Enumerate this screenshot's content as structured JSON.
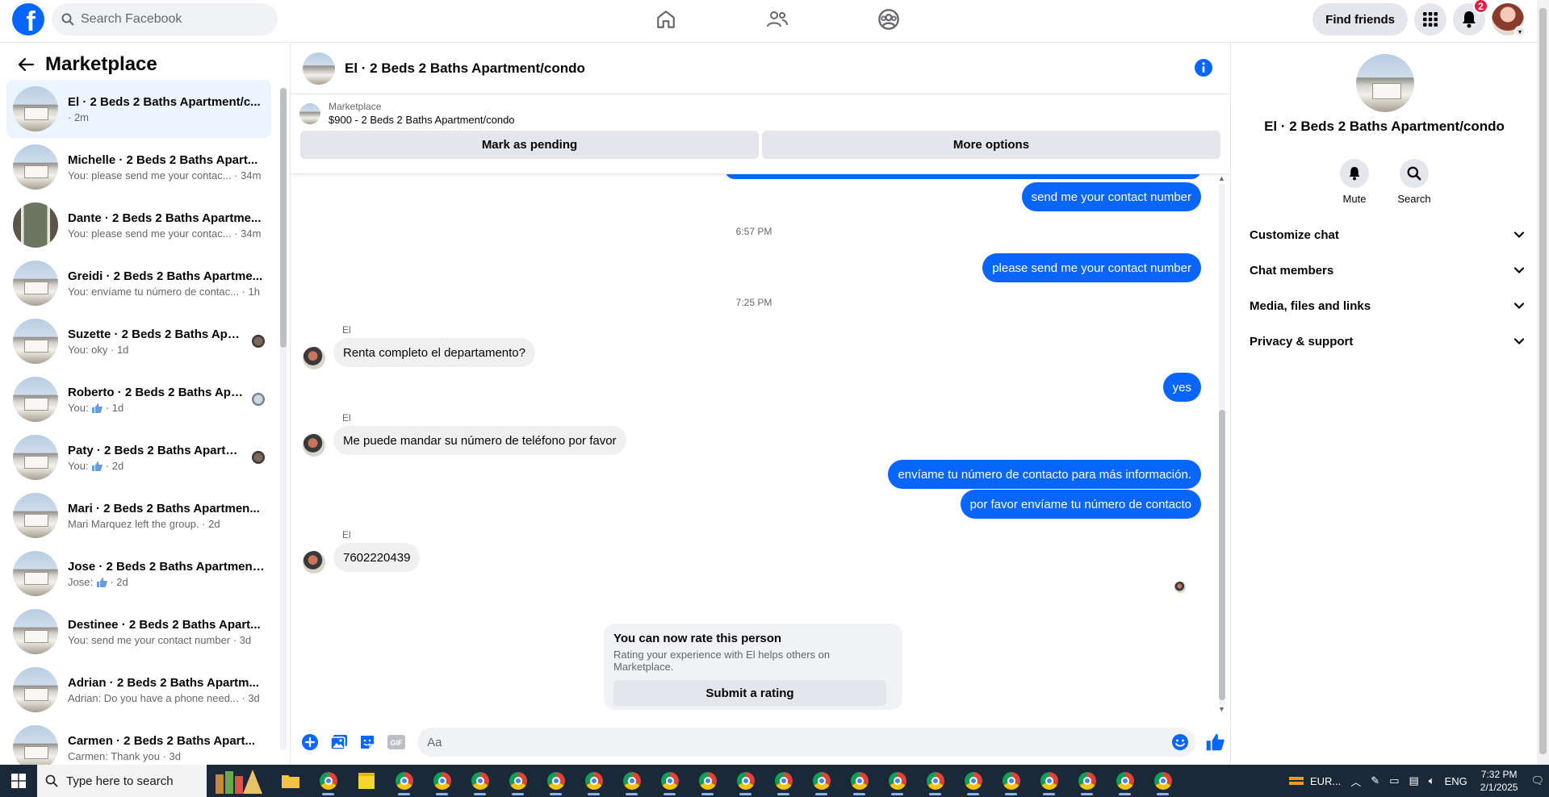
{
  "topnav": {
    "logo": "f",
    "search_placeholder": "Search Facebook",
    "find_friends": "Find friends",
    "notification_count": "2"
  },
  "sidebar": {
    "title": "Marketplace",
    "conversations": [
      {
        "name": "El · 2 Beds 2 Baths Apartment/c...",
        "sub": "· 2m",
        "active": true
      },
      {
        "name": "Michelle · 2 Beds 2 Baths Apart...",
        "sub": "You: please send me your contac... · 34m"
      },
      {
        "name": "Dante · 2 Beds 2 Baths Apartme...",
        "sub": "You: please send me your contac... · 34m"
      },
      {
        "name": "Greidi · 2 Beds 2 Baths Apartme...",
        "sub": "You: envíame tu número de contac... · 1h"
      },
      {
        "name": "Suzette · 2 Beds 2 Baths Apar...",
        "sub": "You: oky · 1d"
      },
      {
        "name": "Roberto · 2 Beds 2 Baths Apa...",
        "sub_prefix": "You:",
        "sub": " · 1d"
      },
      {
        "name": "Paty · 2 Beds 2 Baths Apartm...",
        "sub_prefix": "You:",
        "sub": " · 2d"
      },
      {
        "name": "Mari · 2 Beds 2 Baths Apartmen...",
        "sub": "Mari Marquez left the group. · 2d"
      },
      {
        "name": "Jose · 2 Beds 2 Baths Apartment...",
        "sub_prefix": "Jose:",
        "sub": " · 2d"
      },
      {
        "name": "Destinee · 2 Beds 2 Baths Apart...",
        "sub": "You: send me your contact number · 3d"
      },
      {
        "name": "Adrian · 2 Beds 2 Baths Apartm...",
        "sub": "Adrian: Do you have a phone need... · 3d"
      },
      {
        "name": "Carmen · 2 Beds 2 Baths Apart...",
        "sub": "Carmen: Thank you · 3d"
      }
    ]
  },
  "chat": {
    "title": "El · 2 Beds 2 Baths Apartment/condo",
    "listing_kicker": "Marketplace",
    "listing_title": "$900 - 2 Beds 2 Baths Apartment/condo",
    "mark_pending": "Mark as pending",
    "more_options": "More options",
    "messages": {
      "out1": "send me your contact number",
      "time1": "6:57 PM",
      "out2": "please  send me your contact number",
      "time2": "7:25 PM",
      "sender": "El",
      "in1": "Renta completo el departamento?",
      "out3": "yes",
      "in2": "Me puede mandar su número de teléfono por favor",
      "out4": "envíame tu número de contacto para más información.",
      "out5": "por favor envíame tu número de contacto",
      "in3": "7602220439"
    },
    "rate": {
      "title": "You can now rate this person",
      "subtitle": "Rating your experience with El helps others on Marketplace.",
      "button": "Submit a rating"
    },
    "composer_placeholder": "Aa"
  },
  "right_panel": {
    "name": "El · 2 Beds 2 Baths Apartment/condo",
    "mute": "Mute",
    "search": "Search",
    "menu": [
      "Customize chat",
      "Chat members",
      "Media, files and links",
      "Privacy & support"
    ]
  },
  "taskbar": {
    "search_placeholder": "Type here to search",
    "currency": "EUR...",
    "language": "ENG",
    "time": "7:32 PM",
    "date": "2/1/2025"
  },
  "colors": {
    "brand": "#0866ff",
    "bubble_in": "#f0f0f0",
    "badge": "#e41e3f"
  }
}
